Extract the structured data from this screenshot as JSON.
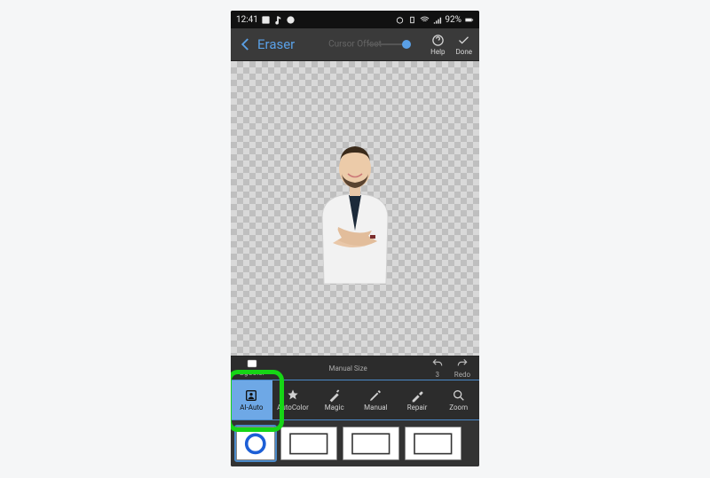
{
  "status": {
    "time": "12:41",
    "battery_text": "92%"
  },
  "appbar": {
    "title": "Eraser",
    "ghost_label": "Cursor Offset",
    "help_label": "Help",
    "done_label": "Done"
  },
  "row1": {
    "bgcolor_label": "BgColor",
    "manual_label": "Manual Size",
    "count": "3",
    "redo_label": "Redo"
  },
  "tools": [
    {
      "label": "AI-Auto"
    },
    {
      "label": "AutoColor"
    },
    {
      "label": "Magic"
    },
    {
      "label": "Manual"
    },
    {
      "label": "Repair"
    },
    {
      "label": "Zoom"
    }
  ]
}
